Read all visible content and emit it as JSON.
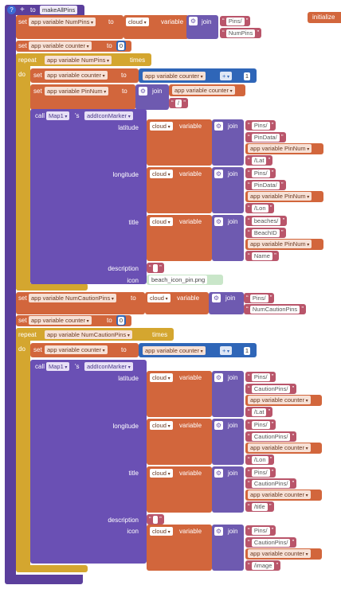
{
  "header": {
    "question_mark": "?",
    "plus": "+",
    "to": "to",
    "proc_name": "makeAllPins",
    "initialize_partial": "initialize"
  },
  "kw": {
    "set": "set",
    "to": "to",
    "repeat": "repeat",
    "do": "do",
    "times": "times",
    "call": "call",
    "s": "'s",
    "join": "join",
    "variable": "variable",
    "cloud": "cloud"
  },
  "vars": {
    "num_pins": "app variable NumPins",
    "counter": "app variable counter",
    "pin_num": "app variable PinNum",
    "num_caution": "app variable NumCautionPins"
  },
  "strings": {
    "pins": "Pins/",
    "num_pins": "NumPins",
    "slash": "/",
    "pin_data": "PinData/",
    "lat": "/Lat",
    "lon": "/Lon",
    "beaches": "beaches/",
    "beach_id": "BeachID",
    "name": "Name",
    "empty": " ",
    "icon_file": "beach_icon_pin.png",
    "num_caution_pins": "NumCautionPins",
    "caution_pins": "CautionPins/",
    "title_s": "/title",
    "image_s": "/image"
  },
  "numbers": {
    "zero": "0",
    "one": "1",
    "plus_op": "+"
  },
  "component": {
    "map": "Map1",
    "method": "addIconMarker"
  },
  "params": {
    "latitude": "latitude",
    "longitude": "longitude",
    "title": "title",
    "description": "description",
    "icon": "icon"
  }
}
